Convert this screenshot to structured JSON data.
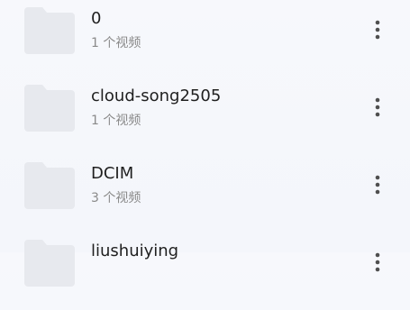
{
  "items": [
    {
      "name": "0",
      "meta": "1 个视频",
      "icon": "folder-icon",
      "menu_icon": "more-vert-icon"
    },
    {
      "name": "cloud-song2505",
      "meta": "1 个视频",
      "icon": "folder-icon",
      "menu_icon": "more-vert-icon"
    },
    {
      "name": "DCIM",
      "meta": "3 个视频",
      "icon": "folder-icon",
      "menu_icon": "more-vert-icon"
    },
    {
      "name": "liushuiying",
      "meta": "",
      "icon": "folder-icon",
      "menu_icon": "more-vert-icon"
    }
  ],
  "colors": {
    "background": "#f5f7fb",
    "folder": "#e7e9ee",
    "title": "#1f1f1f",
    "subtitle": "#8a8a8a",
    "icon": "#4f4f4f"
  }
}
